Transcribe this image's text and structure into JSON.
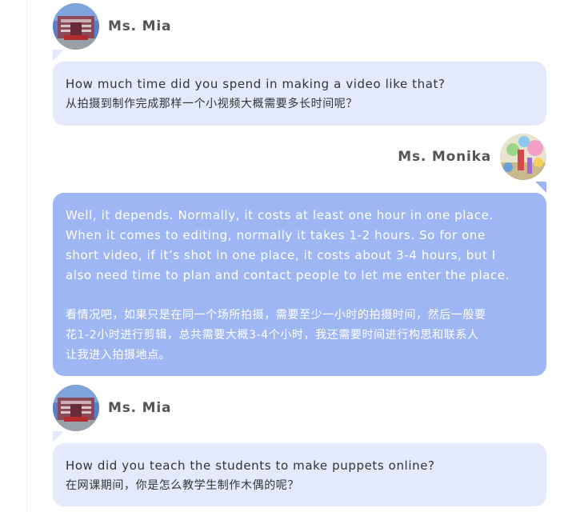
{
  "messages": [
    {
      "speaker": "Ms. Mia",
      "side": "left",
      "en": "How much time did you spend in making a video like that?",
      "zh": "从拍摄到制作完成那样一个小视频大概需要多长时间呢？"
    },
    {
      "speaker": "Ms. Monika",
      "side": "right",
      "en_lines": [
        "Well, it depends. Normally, it costs at least one hour in one place.",
        "When it comes to editing, normally it takes 1-2 hours. So for one",
        "short video, if it’s shot in one place, it costs about 3-4 hours, but I",
        "also need time to plan and contact people to let me enter the place."
      ],
      "zh_lines": [
        "看情况吧，如果只是在同一个场所拍摄，需要至少一小时的拍摄时间，然后一般要",
        "花1-2小时进行剪辑，总共需要大概3-4个小时，我还需要时间进行构思和联系人",
        "让我进入拍摄地点。"
      ]
    },
    {
      "speaker": "Ms. Mia",
      "side": "left",
      "en": "How did you teach the students to make puppets online?",
      "zh": "在网课期间，你是怎么教学生制作木偶的呢？"
    }
  ],
  "colors": {
    "left_bubble": "#e4eafc",
    "right_bubble": "#9fb6f4",
    "name_text": "#555555"
  },
  "icons": {
    "mia_avatar": "school-building-photo",
    "monika_avatar": "colorful-classroom-photo"
  }
}
